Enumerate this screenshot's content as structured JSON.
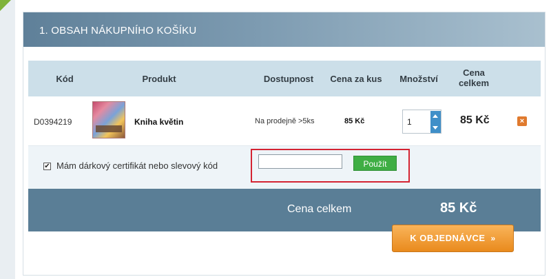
{
  "header": {
    "title": "1. OBSAH NÁKUPNÍHO KOŠÍKU"
  },
  "columns": {
    "code": "Kód",
    "product": "Produkt",
    "availability": "Dostupnost",
    "unit_price": "Cena za kus",
    "quantity": "Množství",
    "total_line1": "Cena",
    "total_line2": "celkem"
  },
  "items": [
    {
      "code": "D0394219",
      "product_name": "Kniha květin",
      "availability": "Na prodejně >5ks",
      "unit_price": "85 Kč",
      "quantity": "1",
      "total": "85 Kč",
      "remove_glyph": "×"
    }
  ],
  "voucher": {
    "checked_glyph": "✔",
    "label": "Mám dárkový certifikát nebo slevový kód",
    "input_value": "",
    "apply_label": "Použít"
  },
  "summary": {
    "label": "Cena celkem",
    "value": "85 Kč"
  },
  "order_button": {
    "label": "K OBJEDNÁVCE",
    "glyph": "»"
  },
  "colors": {
    "header": "#6f8ea5",
    "apply": "#3fae44",
    "order": "#e98a1d",
    "highlight": "#d42332"
  }
}
